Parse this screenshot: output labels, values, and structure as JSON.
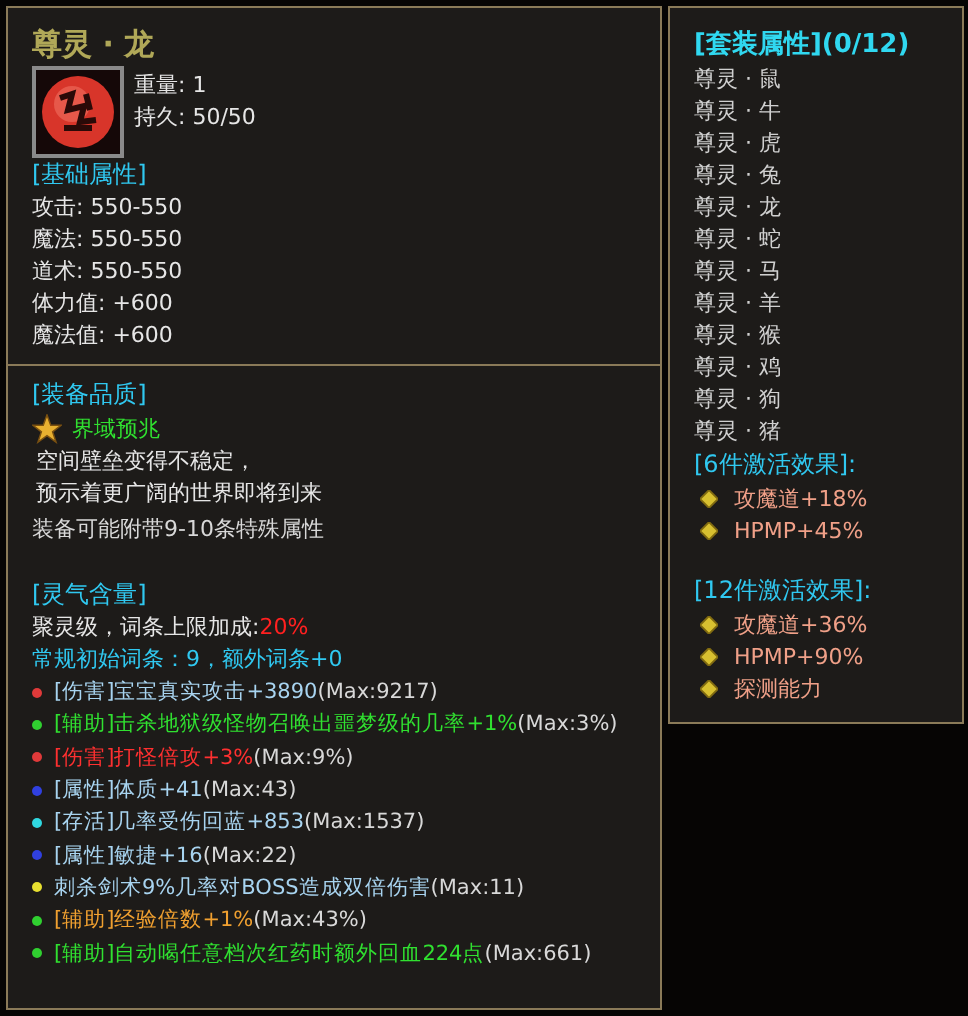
{
  "item": {
    "name": "尊灵 · 龙",
    "weight": "重量: 1",
    "durability": "持久: 50/50"
  },
  "base": {
    "heading": "[基础属性]",
    "stats": [
      "攻击: 550-550",
      "魔法: 550-550",
      "道术: 550-550",
      "体力值: +600",
      "魔法值: +600"
    ]
  },
  "quality": {
    "heading": "[装备品质]",
    "grade": "界域预兆",
    "description": [
      "空间壁垒变得不稳定，",
      "预示着更广阔的世界即将到来"
    ],
    "note": "装备可能附带9-10条特殊属性"
  },
  "spirit": {
    "heading": "[灵气含量]",
    "bonus_label": "聚灵级，词条上限加成:",
    "bonus_value": "20%",
    "counts": "常规初始词条：9，额外词条+0",
    "affixes": [
      {
        "color": "#e03a3a",
        "kind": "normal",
        "text": "[伤害]宝宝真实攻击",
        "bonus": "+3890",
        "max": "(Max:9217)"
      },
      {
        "color": "#30d030",
        "kind": "assist",
        "text": "[辅助]击杀地狱级怪物召唤出噩梦级的几率",
        "bonus": "+1%",
        "max": "(Max:3%)"
      },
      {
        "color": "#e03a3a",
        "kind": "damage",
        "text": "[伤害]打怪倍攻",
        "bonus": "+3%",
        "max": "(Max:9%)"
      },
      {
        "color": "#3040e0",
        "kind": "normal",
        "text": "[属性]体质",
        "bonus": "+41",
        "max": "(Max:43)"
      },
      {
        "color": "#30d8e0",
        "kind": "normal",
        "text": "[存活]几率受伤回蓝",
        "bonus": "+853",
        "max": "(Max:1537)"
      },
      {
        "color": "#3040e0",
        "kind": "normal",
        "text": "[属性]敏捷",
        "bonus": "+16",
        "max": "(Max:22)"
      },
      {
        "color": "#e8e030",
        "kind": "normal",
        "text": "刺杀剑术9%几率对BOSS造成双倍伤害",
        "max": "(Max:11)"
      },
      {
        "color": "#30d030",
        "kind": "rare",
        "text": "[辅助]经验倍数",
        "bonus": "+1%",
        "max": "(Max:43%)"
      },
      {
        "color": "#30d030",
        "kind": "assist",
        "text": "[辅助]自动喝任意档次红药时额外回血224点",
        "max": "(Max:661)"
      }
    ]
  },
  "set": {
    "heading": "[套装属性](0/12)",
    "pieces": [
      "尊灵 · 鼠",
      "尊灵 · 牛",
      "尊灵 · 虎",
      "尊灵 · 兔",
      "尊灵 · 龙",
      "尊灵 · 蛇",
      "尊灵 · 马",
      "尊灵 · 羊",
      "尊灵 · 猴",
      "尊灵 · 鸡",
      "尊灵 · 狗",
      "尊灵 · 猪"
    ],
    "effects": [
      {
        "heading": "[6件激活效果]:",
        "items": [
          "攻魔道+18%",
          "HPMP+45%"
        ]
      },
      {
        "heading": "[12件激活效果]:",
        "items": [
          "攻魔道+36%",
          "HPMP+90%",
          "探测能力"
        ]
      }
    ]
  }
}
